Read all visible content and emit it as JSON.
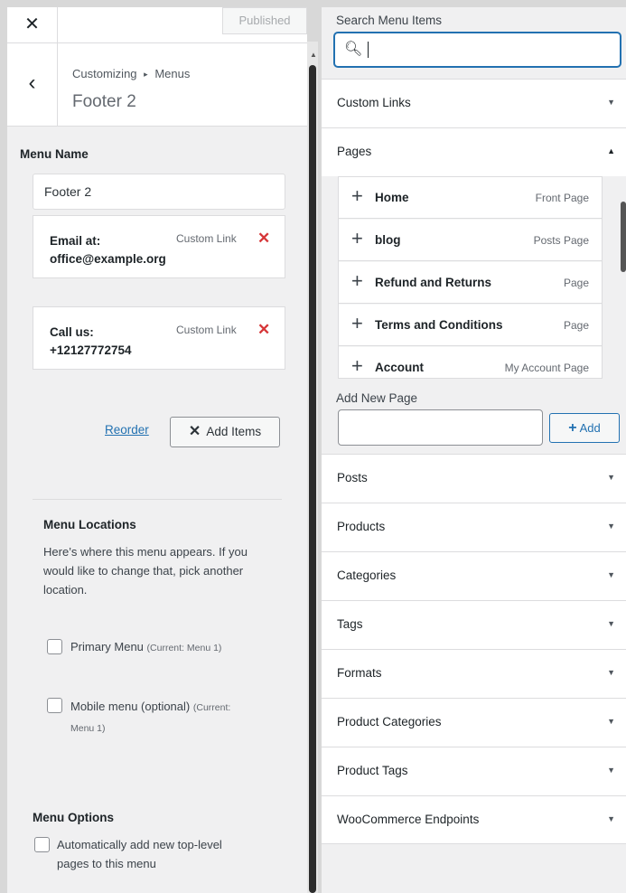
{
  "left": {
    "close_glyph": "✕",
    "publish_label": "Published",
    "back_glyph": "‹",
    "breadcrumb_a": "Customizing",
    "breadcrumb_sep": "▸",
    "breadcrumb_b": "Menus",
    "menu_title": "Footer 2",
    "menu_name_label": "Menu Name",
    "menu_name_value": "Footer 2",
    "items": [
      {
        "title_line1": "Email at:",
        "title_line2": "office@example.org",
        "type": "Custom Link"
      },
      {
        "title_line1": "Call us:",
        "title_line2": "+12127772754",
        "type": "Custom Link"
      }
    ],
    "reorder_label": "Reorder",
    "add_items_label": "Add Items",
    "locations_title": "Menu Locations",
    "locations_desc": "Here’s where this menu appears. If you would like to change that, pick another location.",
    "location_primary": "Primary Menu",
    "location_primary_current": "(Current: Menu 1)",
    "location_mobile": "Mobile menu (optional)",
    "location_mobile_current_a": "(Current:",
    "location_mobile_current_b": "Menu 1)",
    "options_title": "Menu Options",
    "auto_add_label_line1": "Automatically add new top-level",
    "auto_add_label_line2": "pages to this menu"
  },
  "right": {
    "search_label": "Search Menu Items",
    "search_value": "",
    "sections": {
      "custom_links": "Custom Links",
      "pages": "Pages",
      "posts": "Posts",
      "products": "Products",
      "categories": "Categories",
      "tags": "Tags",
      "formats": "Formats",
      "product_categories": "Product Categories",
      "product_tags": "Product Tags",
      "woo_endpoints": "WooCommerce Endpoints"
    },
    "pages": [
      {
        "title": "Home",
        "type": "Front Page"
      },
      {
        "title": "blog",
        "type": "Posts Page"
      },
      {
        "title": "Refund and Returns",
        "type": "Page"
      },
      {
        "title": "Terms and Conditions",
        "type": "Page"
      },
      {
        "title": "Account",
        "type": "My Account Page"
      }
    ],
    "add_new_page_label": "Add New Page",
    "add_new_page_value": "",
    "add_button_label": "Add"
  },
  "colors": {
    "accent": "#2271b1",
    "remove": "#d63638",
    "panel_bg": "#f0f0f1"
  }
}
